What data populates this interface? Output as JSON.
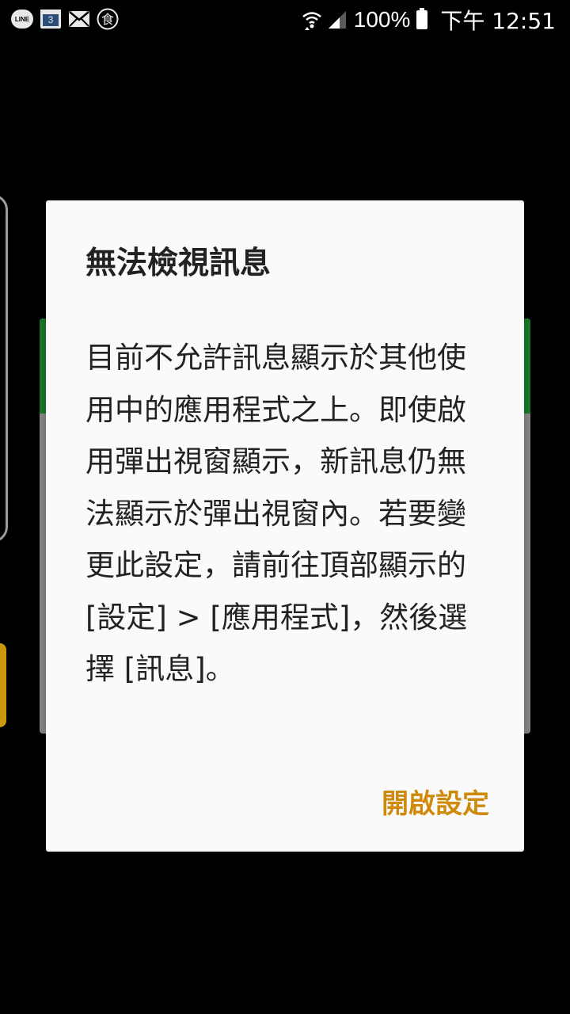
{
  "status_bar": {
    "left_icons": [
      "line-icon",
      "calendar-icon",
      "mail-icon",
      "food-icon"
    ],
    "line_label": "LINE",
    "calendar_day": "3",
    "food_glyph": "食",
    "battery": "100%",
    "clock": "下午 12:51"
  },
  "dialog": {
    "title": "無法檢視訊息",
    "message": "目前不允許訊息顯示於其他使用中的應用程式之上。即使啟用彈出視窗顯示，新訊息仍無法顯示於彈出視窗內。若要變更此設定，請前往頂部顯示的 [設定] > [應用程式]，然後選擇 [訊息]。",
    "button_label": "開啟設定"
  },
  "colors": {
    "dialog_background": "#fafafa",
    "accent": "#d08a0a",
    "header_green": "#1f8b33",
    "background": "#000000"
  }
}
